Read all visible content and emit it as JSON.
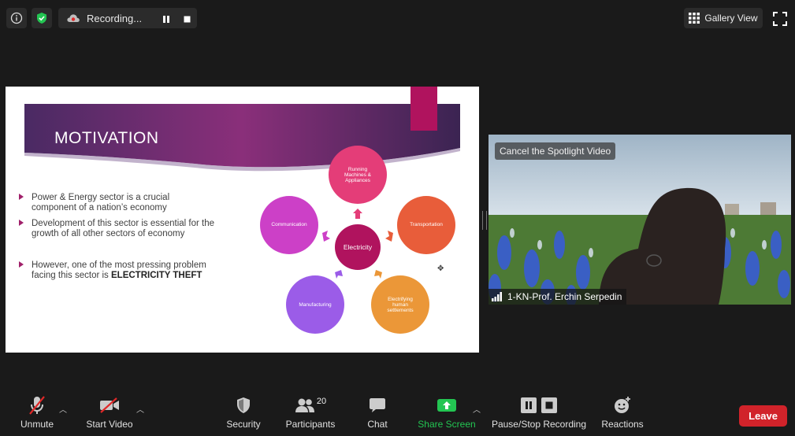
{
  "topbar": {
    "recording_label": "Recording...",
    "gallery_label": "Gallery View"
  },
  "slide": {
    "title": "MOTIVATION",
    "bullets": [
      "Power & Energy sector is a crucial component of a nation’s economy",
      "Development of this sector is essential for the growth of all other sectors of economy",
      "However, one of the most pressing problem facing this sector is"
    ],
    "bullet3_emphasis": "ELECTRICITY THEFT",
    "center_node": "Electricity",
    "nodes": {
      "top": "Running Machines & Appliances",
      "right": "Transportation",
      "bottom_right": "Electrifying human settlements",
      "bottom_left": "Manufacturing",
      "left": "Communication"
    },
    "colors": {
      "center": "#b0135e",
      "top": "#e43d78",
      "right": "#e85d3a",
      "bottom_right": "#eb9738",
      "bottom_left": "#9b5ce8",
      "left": "#cc40c7"
    }
  },
  "spotlight": {
    "cancel_label": "Cancel the Spotlight Video",
    "participant_name": "1-KN-Prof. Erchin Serpedin"
  },
  "toolbar": {
    "unmute": "Unmute",
    "start_video": "Start Video",
    "security": "Security",
    "participants": "Participants",
    "participant_count": "20",
    "chat": "Chat",
    "share_screen": "Share Screen",
    "pause_stop": "Pause/Stop Recording",
    "reactions": "Reactions",
    "leave": "Leave"
  }
}
